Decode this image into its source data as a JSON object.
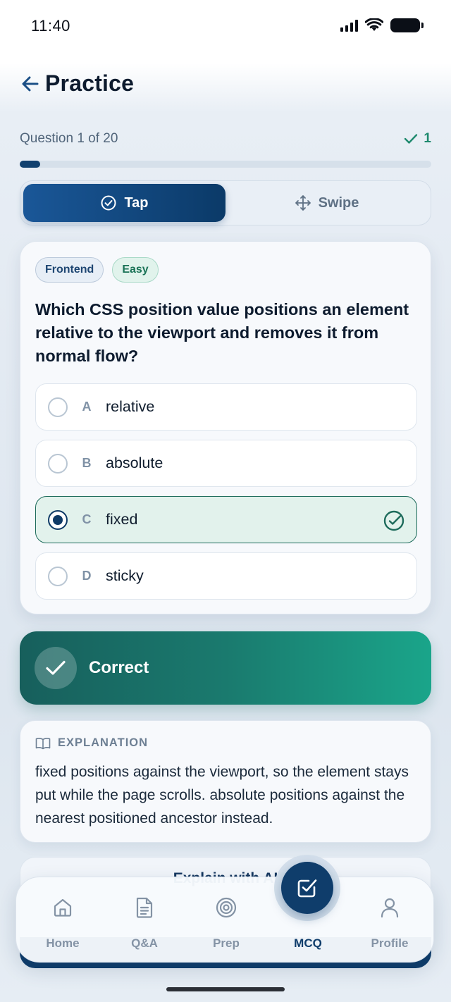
{
  "status_bar": {
    "time": "11:40"
  },
  "header": {
    "title": "Practice"
  },
  "progress": {
    "counter": "Question 1 of 20",
    "correct_count": "1",
    "fraction": 0.05
  },
  "mode_toggle": {
    "tap_label": "Tap",
    "swipe_label": "Swipe",
    "active": "tap"
  },
  "question": {
    "tags": [
      "Frontend",
      "Easy"
    ],
    "text": "Which CSS position value positions an element relative to the viewport and removes it from normal flow?",
    "options": [
      {
        "letter": "A",
        "text": "relative"
      },
      {
        "letter": "B",
        "text": "absolute"
      },
      {
        "letter": "C",
        "text": "fixed"
      },
      {
        "letter": "D",
        "text": "sticky"
      }
    ],
    "selected_index": 2
  },
  "result": {
    "label": "Correct"
  },
  "explanation": {
    "heading": "EXPLANATION",
    "body": "fixed positions against the viewport, so the element stays put while the page scrolls. absolute positions against the nearest positioned ancestor instead."
  },
  "ai_explain": {
    "label": "Explain with AI"
  },
  "tabbar": {
    "items": [
      {
        "label": "Home",
        "icon": "home-icon"
      },
      {
        "label": "Q&A",
        "icon": "document-icon"
      },
      {
        "label": "Prep",
        "icon": "target-icon"
      },
      {
        "label": "MCQ",
        "icon": "checkbox-icon"
      },
      {
        "label": "Profile",
        "icon": "user-icon"
      }
    ],
    "active_index": 3
  },
  "colors": {
    "primary": "#0f3d6b",
    "success": "#1a7a6e",
    "accent_green": "#1f8a6e"
  }
}
